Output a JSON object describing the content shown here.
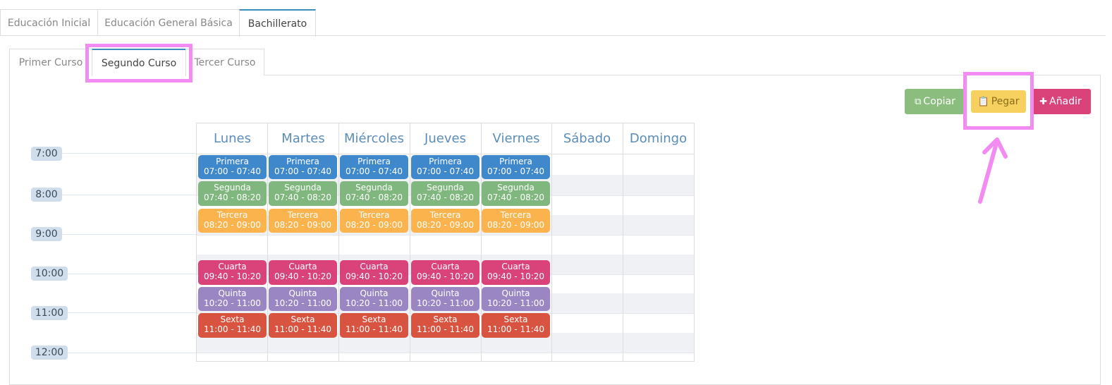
{
  "top_tabs": [
    {
      "label": "Educación Inicial",
      "active": false
    },
    {
      "label": "Educación General Básica",
      "active": false
    },
    {
      "label": "Bachillerato",
      "active": true
    }
  ],
  "inner_tabs": [
    {
      "label": "Primer Curso",
      "active": false
    },
    {
      "label": "Segundo Curso",
      "active": true
    },
    {
      "label": "Tercer Curso",
      "active": false
    }
  ],
  "toolbar": {
    "copy_label": "Copiar",
    "paste_label": "Pegar",
    "add_label": "Añadir"
  },
  "times": [
    "7:00",
    "8:00",
    "9:00",
    "10:00",
    "11:00",
    "12:00"
  ],
  "days": [
    "Lunes",
    "Martes",
    "Miércoles",
    "Jueves",
    "Viernes",
    "Sábado",
    "Domingo"
  ],
  "periods": [
    {
      "name": "Primera",
      "range": "07:00 - 07:40",
      "color": "#3f88cc"
    },
    {
      "name": "Segunda",
      "range": "07:40 - 08:20",
      "color": "#7fb77e"
    },
    {
      "name": "Tercera",
      "range": "08:20 - 09:00",
      "color": "#fbb44d"
    },
    {
      "name": "Cuarta",
      "range": "09:40 - 10:20",
      "color": "#d9437a"
    },
    {
      "name": "Quinta",
      "range": "10:20 - 11:00",
      "color": "#9b86c4"
    },
    {
      "name": "Sexta",
      "range": "11:00 - 11:40",
      "color": "#d95440"
    }
  ],
  "colors": {
    "tab_accent": "#3c8dbc",
    "highlight": "#f28cf2",
    "copy_button": "#8bbe7e",
    "paste_button": "#f6d160",
    "add_button": "#d9437a"
  }
}
